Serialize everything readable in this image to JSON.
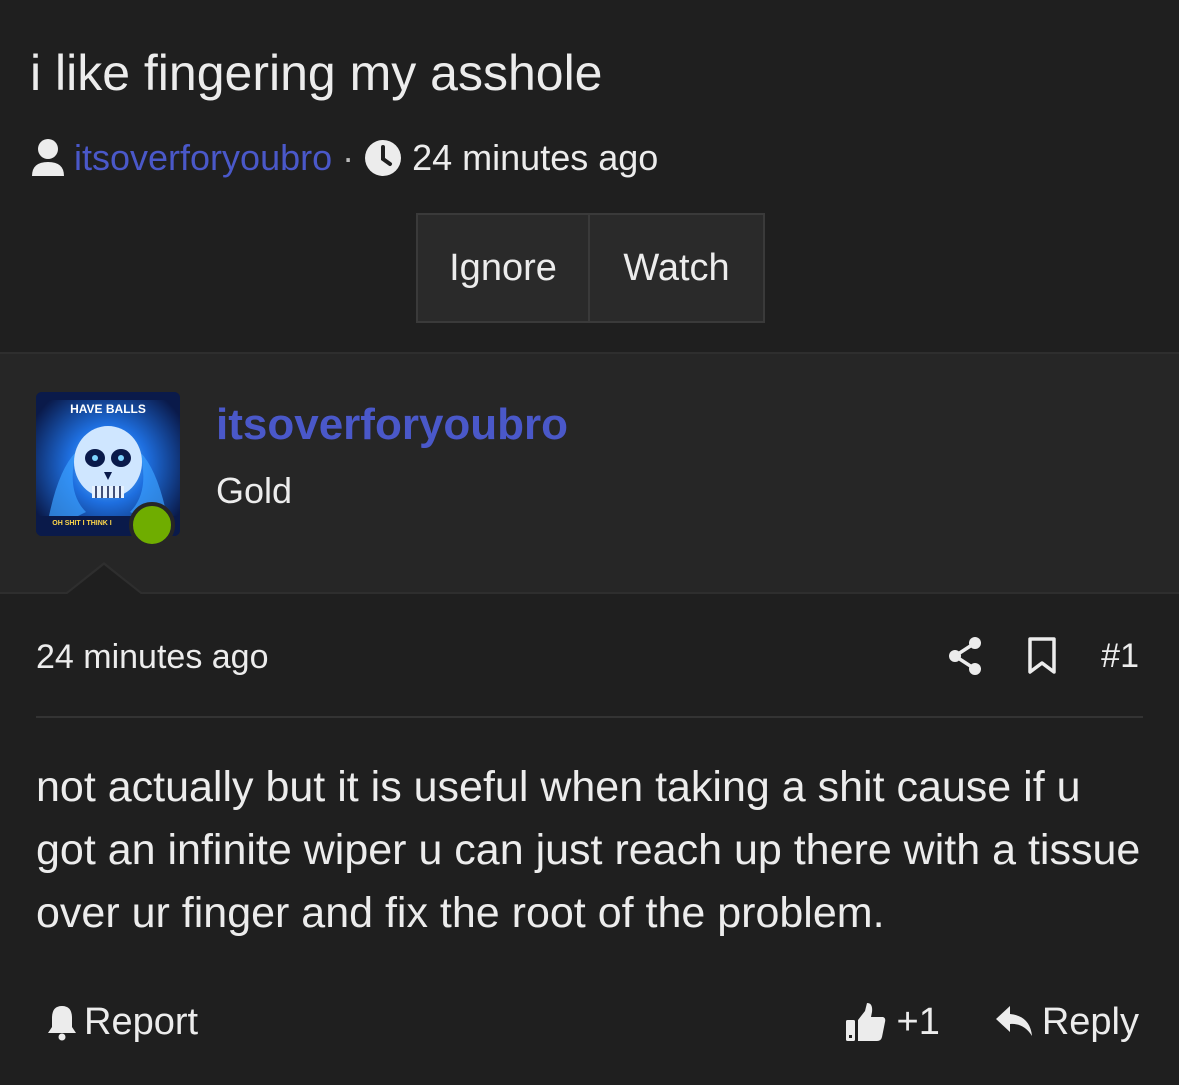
{
  "thread": {
    "title": "i like fingering my asshole",
    "author": "itsoverforyoubro",
    "separator": "·",
    "time": "24 minutes ago"
  },
  "buttons": {
    "ignore": "Ignore",
    "watch": "Watch"
  },
  "post": {
    "author": "itsoverforyoubro",
    "user_title": "Gold",
    "avatar_text_top": "HAVE BALLS",
    "avatar_text_bottom": "OH SHIT I THINK I",
    "time": "24 minutes ago",
    "number": "#1",
    "message": "not actually but it is useful when taking a shit cause if u got an infinite wiper u can just reach up there with a tissue over ur finger and fix the root of the problem.",
    "report_label": "Report",
    "like_count": "+1",
    "reply_label": "Reply",
    "online_color": "#6fad00"
  },
  "colors": {
    "link": "#4a58c9",
    "background": "#1f1f1f",
    "panel": "#262626"
  },
  "icons": [
    "user-icon",
    "clock-icon",
    "share-icon",
    "bookmark-icon",
    "bell-icon",
    "thumbs-up-icon",
    "reply-icon"
  ]
}
